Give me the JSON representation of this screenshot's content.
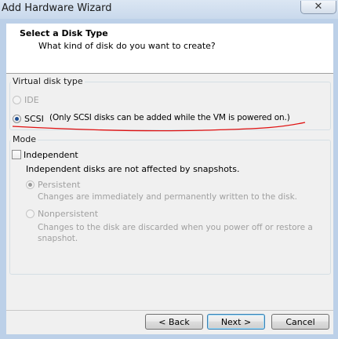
{
  "window": {
    "title": "Add Hardware Wizard",
    "close_glyph": "✕"
  },
  "header": {
    "title": "Select a Disk Type",
    "subtitle": "What kind of disk do you want to create?"
  },
  "disk_type": {
    "legend": "Virtual disk type",
    "options": [
      {
        "label": "IDE",
        "selected": false,
        "enabled": false
      },
      {
        "label": "SCSI",
        "selected": true,
        "enabled": true,
        "note": "(Only SCSI disks can be added while the VM is powered on.)"
      }
    ]
  },
  "mode": {
    "legend": "Mode",
    "independent_label": "Independent",
    "independent_checked": false,
    "independent_desc": "Independent disks are not affected by snapshots.",
    "persistent_label": "Persistent",
    "persistent_desc": "Changes are immediately and permanently written to the disk.",
    "nonpersistent_label": "Nonpersistent",
    "nonpersistent_desc_line1": "Changes to the disk are discarded when you power off or restore a",
    "nonpersistent_desc_line2": "snapshot."
  },
  "buttons": {
    "back": "< Back",
    "next": "Next >",
    "cancel": "Cancel"
  },
  "colors": {
    "frame": "#bcd0e8",
    "annotation_underline": "#e01010",
    "radio_dot": "#1f4f92"
  }
}
